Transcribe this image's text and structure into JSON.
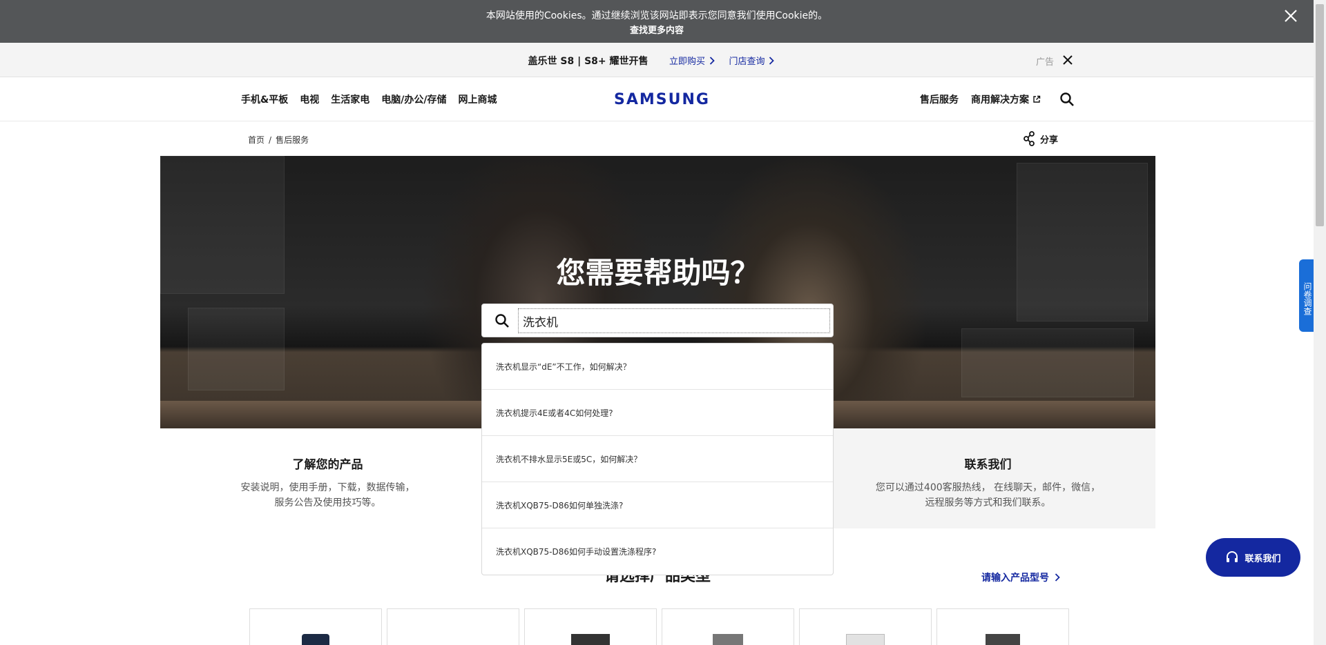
{
  "cookie": {
    "text": "本网站使用的Cookies。通过继续浏览该网站即表示您同意我们使用Cookie的。",
    "link": "查找更多内容"
  },
  "promo": {
    "title": "盖乐世 S8 | S8+ 耀世开售",
    "links": [
      "立即购买",
      "门店查询"
    ],
    "ad_label": "广告"
  },
  "nav": {
    "left": [
      "手机&平板",
      "电视",
      "生活家电",
      "电脑/办公/存储",
      "网上商城"
    ],
    "logo": "SAMSUNG",
    "right": [
      "售后服务",
      "商用解决方案"
    ]
  },
  "breadcrumb": {
    "items": [
      "首页",
      "售后服务"
    ],
    "separator": "/",
    "share_label": "分享"
  },
  "hero": {
    "title": "您需要帮助吗？"
  },
  "search": {
    "value": "洗衣机",
    "suggestions": [
      "洗衣机显示“dE”不工作，如何解决？",
      "洗衣机提示4E或者4C如何处理?",
      "洗衣机不排水显示5E或5C，如何解决？",
      "洗衣机XQB75-D86如何单独洗涤?",
      "洗衣机XQB75-D86如何手动设置洗涤程序?"
    ]
  },
  "cards": {
    "left": {
      "title": "了解您的产品",
      "desc_line1": "安装说明，使用手册，下载，数据传输，",
      "desc_line2": "服务公告及使用技巧等。"
    },
    "right": {
      "title": "联系我们",
      "desc_line1": "您可以通过400客服热线， 在线聊天，邮件，微信，",
      "desc_line2": "远程服务等方式和我们联系。"
    }
  },
  "products": {
    "title_partial": "请选择产品类型",
    "model_link": "请输入产品型号"
  },
  "floating": {
    "survey": "问卷调查",
    "contact": "联系我们"
  },
  "colors": {
    "brand": "#1428a0",
    "cookie_bg": "#545658",
    "survey_bg": "#1a6ed8"
  }
}
